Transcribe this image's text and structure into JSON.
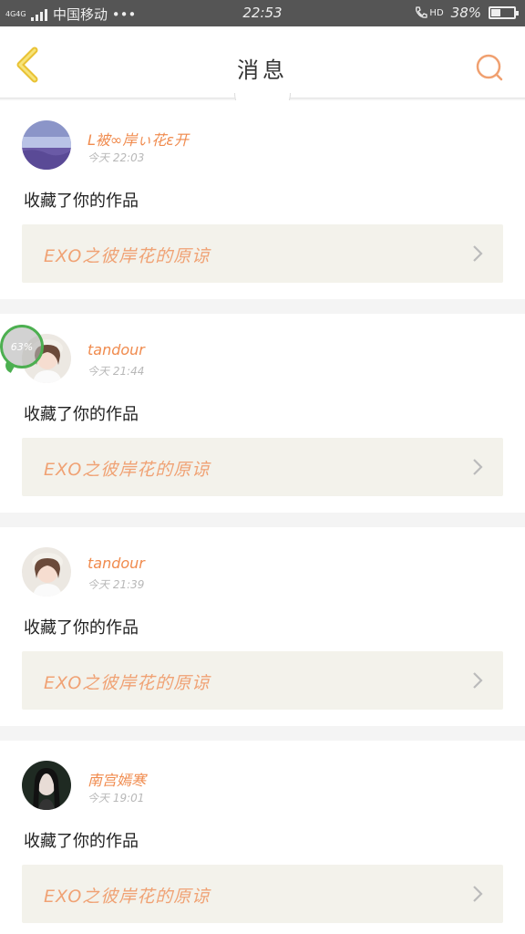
{
  "status_bar": {
    "network": "4G4G",
    "carrier": "中国移动 •••",
    "time": "22:53",
    "hd": "HD",
    "battery": "38%",
    "battery_level": 0.38
  },
  "header": {
    "title": "消息"
  },
  "progress_badge": {
    "text": "63%"
  },
  "messages": [
    {
      "username": "L被∞岸ぃ花ε开",
      "time": "今天 22:03",
      "action": "收藏了你的作品",
      "work_title": "EXO之彼岸花的原谅"
    },
    {
      "username": "tandour",
      "time": "今天 21:44",
      "action": "收藏了你的作品",
      "work_title": "EXO之彼岸花的原谅"
    },
    {
      "username": "tandour",
      "time": "今天 21:39",
      "action": "收藏了你的作品",
      "work_title": "EXO之彼岸花的原谅"
    },
    {
      "username": "南宫嫣寒",
      "time": "今天 19:01",
      "action": "收藏了你的作品",
      "work_title": "EXO之彼岸花的原谅"
    }
  ]
}
